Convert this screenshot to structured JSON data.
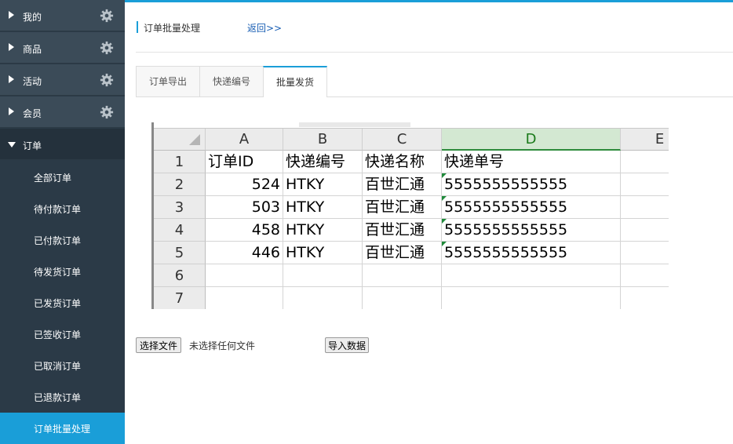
{
  "sidebar": {
    "menus": [
      {
        "label": "我的",
        "icon": "gear-icon"
      },
      {
        "label": "商品",
        "icon": "gear-icon"
      },
      {
        "label": "活动",
        "icon": "gear-icon"
      },
      {
        "label": "会员",
        "icon": "gear-icon"
      },
      {
        "label": "订单"
      }
    ],
    "order_items": [
      {
        "label": "全部订单"
      },
      {
        "label": "待付款订单"
      },
      {
        "label": "已付款订单"
      },
      {
        "label": "待发货订单"
      },
      {
        "label": "已发货订单"
      },
      {
        "label": "已签收订单"
      },
      {
        "label": "已取消订单"
      },
      {
        "label": "已退款订单"
      },
      {
        "label": "订单批量处理",
        "active": true
      }
    ]
  },
  "header": {
    "title": "订单批量处理",
    "back_link": "返回>>"
  },
  "tabs": [
    {
      "label": "订单导出"
    },
    {
      "label": "快递编号"
    },
    {
      "label": "批量发货",
      "active": true
    }
  ],
  "spreadsheet": {
    "columns": [
      "A",
      "B",
      "C",
      "D",
      "E"
    ],
    "selected_column": "D",
    "row_numbers": [
      "1",
      "2",
      "3",
      "4",
      "5",
      "6",
      "7"
    ],
    "rows": [
      [
        "订单ID",
        "快递编号",
        "快递名称",
        "快递单号",
        ""
      ],
      [
        "524",
        "HTKY",
        "百世汇通",
        "5555555555555",
        ""
      ],
      [
        "503",
        "HTKY",
        "百世汇通",
        "5555555555555",
        ""
      ],
      [
        "458",
        "HTKY",
        "百世汇通",
        "5555555555555",
        ""
      ],
      [
        "446",
        "HTKY",
        "百世汇通",
        "5555555555555",
        ""
      ],
      [
        "",
        "",
        "",
        "",
        ""
      ],
      [
        "",
        "",
        "",
        "",
        ""
      ]
    ]
  },
  "upload": {
    "choose_file_label": "选择文件",
    "file_status": "未选择任何文件",
    "import_label": "导入数据"
  },
  "colors": {
    "accent": "#1a9ed8",
    "sidebar_bg": "#2b3a47",
    "menu_bg": "#3b4b58",
    "selected_column_bg": "#d3e8d2"
  }
}
